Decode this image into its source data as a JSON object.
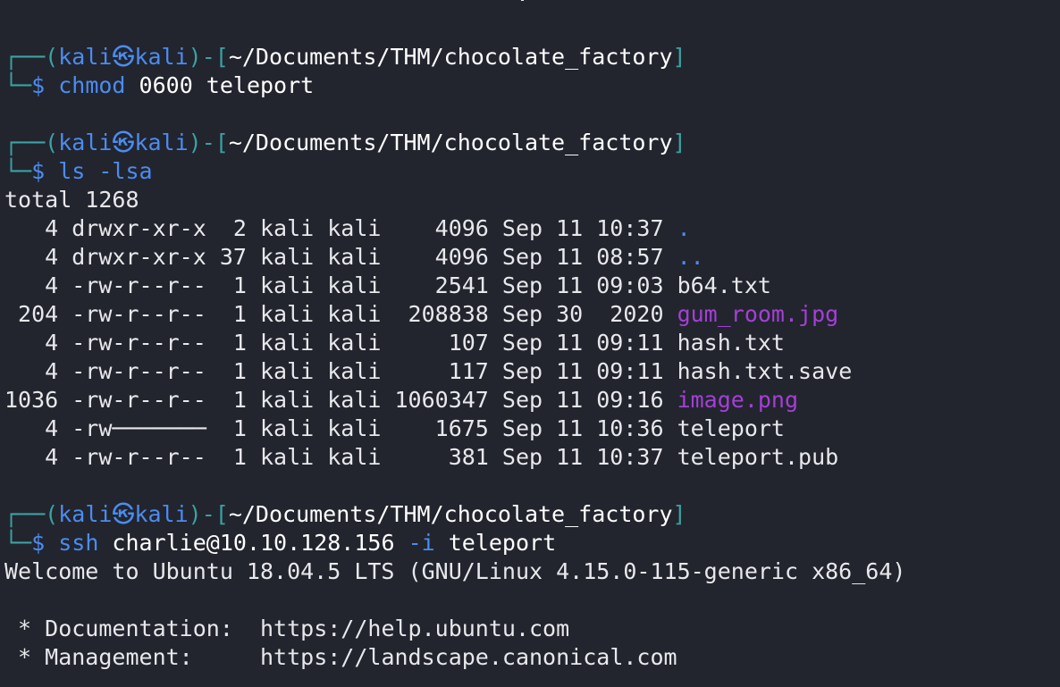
{
  "top_cut_line": "                                      ·                                   ",
  "prompts": [
    {
      "user": "kali",
      "host": "kali",
      "path": "~/Documents/THM/chocolate_factory",
      "command": "chmod",
      "args": " 0600 teleport"
    },
    {
      "user": "kali",
      "host": "kali",
      "path": "~/Documents/THM/chocolate_factory",
      "command": "ls",
      "args": " -lsa"
    },
    {
      "user": "kali",
      "host": "kali",
      "path": "~/Documents/THM/chocolate_factory",
      "command": "ssh",
      "args_pre": " charlie@10.10.128.156 ",
      "args_opt": "-i",
      "args_post": " teleport"
    }
  ],
  "ls_total": "total 1268",
  "ls_rows": [
    {
      "meta": "   4 drwxr-xr-x  2 kali kali    4096 Sep 11 10:37 ",
      "name": ".",
      "kind": "dir"
    },
    {
      "meta": "   4 drwxr-xr-x 37 kali kali    4096 Sep 11 08:57 ",
      "name": "..",
      "kind": "dir"
    },
    {
      "meta": "   4 -rw-r--r--  1 kali kali    2541 Sep 11 09:03 ",
      "name": "b64.txt",
      "kind": "plain"
    },
    {
      "meta": " 204 -rw-r--r--  1 kali kali  208838 Sep 30  2020 ",
      "name": "gum_room.jpg",
      "kind": "img"
    },
    {
      "meta": "   4 -rw-r--r--  1 kali kali     107 Sep 11 09:11 ",
      "name": "hash.txt",
      "kind": "plain"
    },
    {
      "meta": "   4 -rw-r--r--  1 kali kali     117 Sep 11 09:11 ",
      "name": "hash.txt.save",
      "kind": "plain"
    },
    {
      "meta": "1036 -rw-r--r--  1 kali kali 1060347 Sep 11 09:16 ",
      "name": "image.png",
      "kind": "img"
    },
    {
      "meta": "   4 -rw───────  1 kali kali    1675 Sep 11 10:36 ",
      "name": "teleport",
      "kind": "plain"
    },
    {
      "meta": "   4 -rw-r--r--  1 kali kali     381 Sep 11 10:37 ",
      "name": "teleport.pub",
      "kind": "plain"
    }
  ],
  "ssh_output": {
    "welcome": "Welcome to Ubuntu 18.04.5 LTS (GNU/Linux 4.15.0-115-generic x86_64)",
    "doc_label": " * Documentation:  ",
    "doc_url": "https://help.ubuntu.com",
    "mgmt_label": " * Management:     ",
    "mgmt_url": "https://landscape.canonical.com"
  },
  "glyphs": {
    "frame_top": "┌──(",
    "frame_mid": ")-[",
    "frame_end": "]",
    "frame_bottom": "└─",
    "dollar": "$ ",
    "skull": "㉿"
  },
  "colors": {
    "background": "#22252e",
    "frame": "#3ba2a3",
    "user": "#4b8cf0",
    "directory": "#4b8cf0",
    "image": "#a53fd7",
    "text": "#e8e8ec"
  }
}
